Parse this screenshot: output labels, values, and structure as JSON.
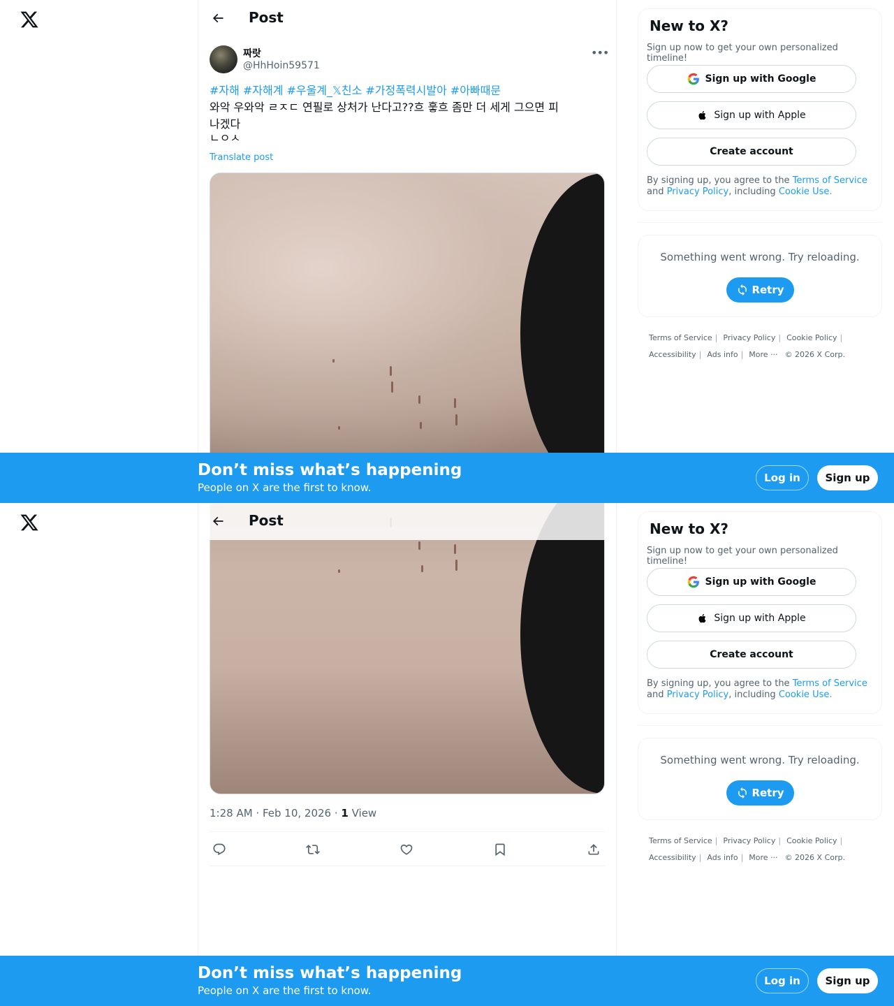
{
  "app": {
    "logo_icon": "x-logo-icon"
  },
  "header": {
    "title": "Post",
    "back_icon": "arrow-left-icon"
  },
  "post": {
    "author_name": "짜랏",
    "author_handle": "@HhHoin59571",
    "hashtags": [
      "#자해",
      "#자해계",
      "#우울계_𝕏친소",
      "#가정폭력시발아",
      "#아빠때문"
    ],
    "text_line1": "와악 우와악 ㄹㅈㄷ 연필로 상처가 난다고??흐 훟흐 좀만 더 세게 그으면 피",
    "text_line2": "나겠다",
    "text_line3": "ㄴㅇㅅ",
    "translate_label": "Translate post",
    "time": "1:28 AM · Feb 10, 2026 · ",
    "views_count": "1",
    "views_label": " View",
    "actions": [
      "reply-icon",
      "repost-icon",
      "like-icon",
      "bookmark-icon",
      "share-icon"
    ]
  },
  "sidebar": {
    "signup_card": {
      "title": "New to X?",
      "subtitle": "Sign up now to get your own personalized timeline!",
      "google_label": "Sign up with Google",
      "apple_label": "Sign up with Apple",
      "create_label": "Create account",
      "legal_prefix": "By signing up, you agree to the ",
      "terms_link": "Terms of Service",
      "legal_and": " and ",
      "privacy_link": "Privacy Policy",
      "legal_including": ", including ",
      "cookie_link": "Cookie Use."
    },
    "error_card": {
      "message": "Something went wrong. Try reloading.",
      "retry_label": "Retry"
    },
    "footer": {
      "terms": "Terms of Service",
      "privacy": "Privacy Policy",
      "cookie": "Cookie Policy",
      "accessibility": "Accessibility",
      "ads": "Ads info",
      "more": "More ···",
      "copyright": "© 2026 X Corp."
    }
  },
  "banner": {
    "title": "Don’t miss what’s happening",
    "subtitle": "People on X are the first to know.",
    "login_label": "Log in",
    "signup_label": "Sign up"
  },
  "colors": {
    "accent": "#1d9bf0",
    "text": "#0f1419",
    "muted": "#536471"
  }
}
